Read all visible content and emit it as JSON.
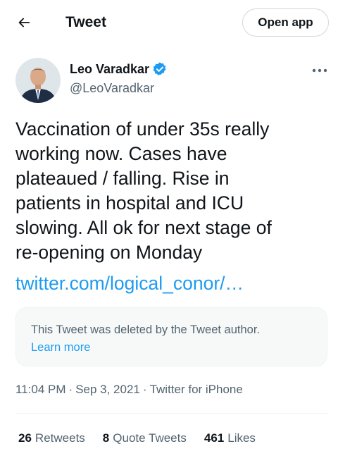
{
  "header": {
    "title": "Tweet",
    "open_app_label": "Open app"
  },
  "author": {
    "display_name": "Leo Varadkar",
    "handle": "@LeoVaradkar",
    "verified": true
  },
  "tweet": {
    "text": "Vaccination of under 35s really\nworking now. Cases have\nplateaued / falling.  Rise in\npatients in hospital and ICU\nslowing. All ok for next stage of\nre-opening on Monday",
    "link_text": "twitter.com/logical_conor/…"
  },
  "quoted_card": {
    "message": "This Tweet was deleted by the Tweet author.",
    "learn_more": "Learn more"
  },
  "meta": {
    "time": "11:04 PM",
    "separator": "·",
    "date": "Sep 3, 2021",
    "source": "Twitter for iPhone"
  },
  "stats": {
    "retweets_count": "26",
    "retweets_label": "Retweets",
    "quotes_count": "8",
    "quotes_label": "Quote Tweets",
    "likes_count": "461",
    "likes_label": "Likes"
  },
  "colors": {
    "accent": "#1d9bf0",
    "secondary_text": "#536471",
    "text": "#0f1419"
  },
  "icons": [
    "back-arrow-icon",
    "verified-badge-icon",
    "more-icon"
  ]
}
